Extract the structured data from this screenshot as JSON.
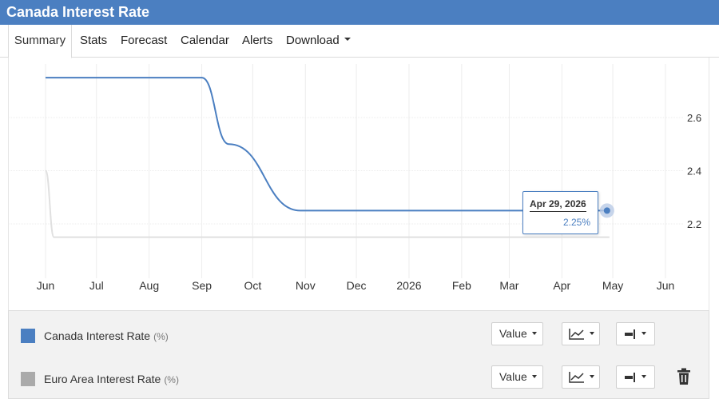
{
  "page": {
    "title": "Canada Interest Rate"
  },
  "tabs": [
    {
      "label": "Summary",
      "active": true
    },
    {
      "label": "Stats"
    },
    {
      "label": "Forecast"
    },
    {
      "label": "Calendar"
    },
    {
      "label": "Alerts"
    },
    {
      "label": "Download",
      "has_dropdown": true
    }
  ],
  "tooltip": {
    "date": "Apr 29, 2026",
    "value": "2.25%"
  },
  "legend": {
    "rows": [
      {
        "name": "Canada Interest Rate",
        "unit": "(%)",
        "color": "#4b7fc1",
        "value_label": "Value",
        "line_icon": "line-chart-icon",
        "axis_icon": "axis-toggle-icon"
      },
      {
        "name": "Euro Area Interest Rate",
        "unit": "(%)",
        "color": "#aaaaaa",
        "value_label": "Value",
        "line_icon": "line-chart-icon",
        "axis_icon": "axis-toggle-icon",
        "delete_icon": "trash-icon"
      }
    ]
  },
  "chart_data": {
    "type": "line",
    "title": "",
    "x_tick_labels": [
      "Jun",
      "Jul",
      "Aug",
      "Sep",
      "Oct",
      "Nov",
      "Dec",
      "2026",
      "Feb",
      "Mar",
      "Apr",
      "May",
      "Jun"
    ],
    "xlim": [
      "2025-06-01",
      "2026-06-01"
    ],
    "y_tick_labels": [
      "2.2",
      "2.4",
      "2.6"
    ],
    "ylim": [
      2.0,
      2.78
    ],
    "y_axis_position": "right",
    "grid": true,
    "highlighted_point": {
      "x": "2026-04-29",
      "y": 2.25,
      "series": "Canada Interest Rate"
    },
    "series": [
      {
        "name": "Canada Interest Rate",
        "unit": "%",
        "color": "#4b7fc1",
        "points": [
          {
            "x": "2025-06-01",
            "y": 2.75
          },
          {
            "x": "2025-09-01",
            "y": 2.75
          },
          {
            "x": "2025-09-17",
            "y": 2.5
          },
          {
            "x": "2025-10-29",
            "y": 2.25
          },
          {
            "x": "2026-04-29",
            "y": 2.25
          }
        ]
      },
      {
        "name": "Euro Area Interest Rate",
        "unit": "%",
        "color": "#e0e0e0",
        "points": [
          {
            "x": "2025-06-01",
            "y": 2.4
          },
          {
            "x": "2025-06-06",
            "y": 2.15
          },
          {
            "x": "2026-04-29",
            "y": 2.15
          }
        ]
      }
    ]
  }
}
